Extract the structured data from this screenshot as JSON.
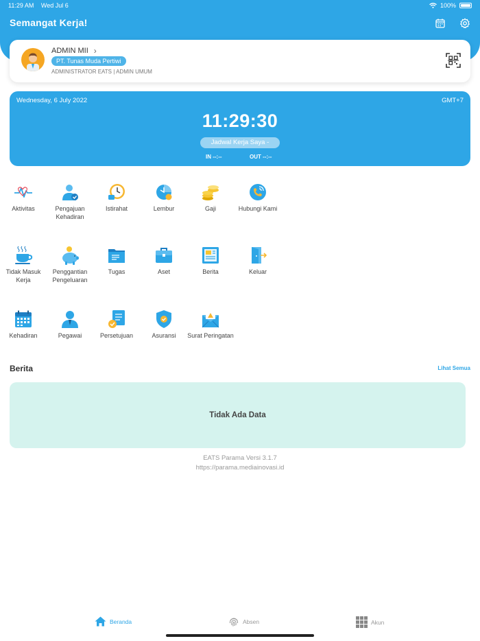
{
  "status_bar": {
    "time": "11:29 AM",
    "date": "Wed Jul 6",
    "battery": "100%"
  },
  "header": {
    "greeting": "Semangat Kerja!",
    "icons": [
      "calendar-icon",
      "settings-icon"
    ]
  },
  "profile": {
    "name": "ADMIN MII",
    "company": "PT. Tunas Muda Pertiwi",
    "role": "ADMINISTRATOR EATS | ADMIN UMUM"
  },
  "clock": {
    "date": "Wednesday, 6 July 2022",
    "timezone": "GMT+7",
    "time": "11:29:30",
    "schedule": "Jadwal Kerja Saya  -",
    "in": "IN --:--",
    "out": "OUT --:--"
  },
  "menu": [
    {
      "label": "Aktivitas",
      "icon": "activity-icon"
    },
    {
      "label": "Pengajuan Kehadiran",
      "icon": "attendance-request-icon"
    },
    {
      "label": "Istirahat",
      "icon": "break-clock-icon"
    },
    {
      "label": "Lembur",
      "icon": "overtime-icon"
    },
    {
      "label": "Gaji",
      "icon": "salary-coins-icon"
    },
    {
      "label": "Hubungi Kami",
      "icon": "phone-contact-icon"
    },
    {
      "label": "Tidak Masuk Kerja",
      "icon": "coffee-cup-icon"
    },
    {
      "label": "Penggantian Pengeluaran",
      "icon": "piggy-bank-icon"
    },
    {
      "label": "Tugas",
      "icon": "task-folder-icon"
    },
    {
      "label": "Aset",
      "icon": "briefcase-icon"
    },
    {
      "label": "Berita",
      "icon": "news-icon"
    },
    {
      "label": "Keluar",
      "icon": "exit-door-icon"
    },
    {
      "label": "Kehadiran",
      "icon": "calendar-grid-icon"
    },
    {
      "label": "Pegawai",
      "icon": "employee-icon"
    },
    {
      "label": "Persetujuan",
      "icon": "approval-document-icon"
    },
    {
      "label": "Asuransi",
      "icon": "insurance-shield-icon"
    },
    {
      "label": "Surat Peringatan",
      "icon": "warning-letter-icon"
    }
  ],
  "news": {
    "title": "Berita",
    "see_all": "Lihat Semua",
    "empty": "Tidak Ada Data"
  },
  "footer": {
    "version": "EATS Parama Versi 3.1.7",
    "url": "https://parama.mediainovasi.id"
  },
  "tabs": [
    {
      "label": "Beranda",
      "icon": "home-icon",
      "active": true
    },
    {
      "label": "Absen",
      "icon": "fingerprint-icon",
      "active": false
    },
    {
      "label": "Akun",
      "icon": "grid-menu-icon",
      "active": false
    }
  ],
  "colors": {
    "primary": "#2ea6e6",
    "news_bg": "#d5f3ee"
  }
}
